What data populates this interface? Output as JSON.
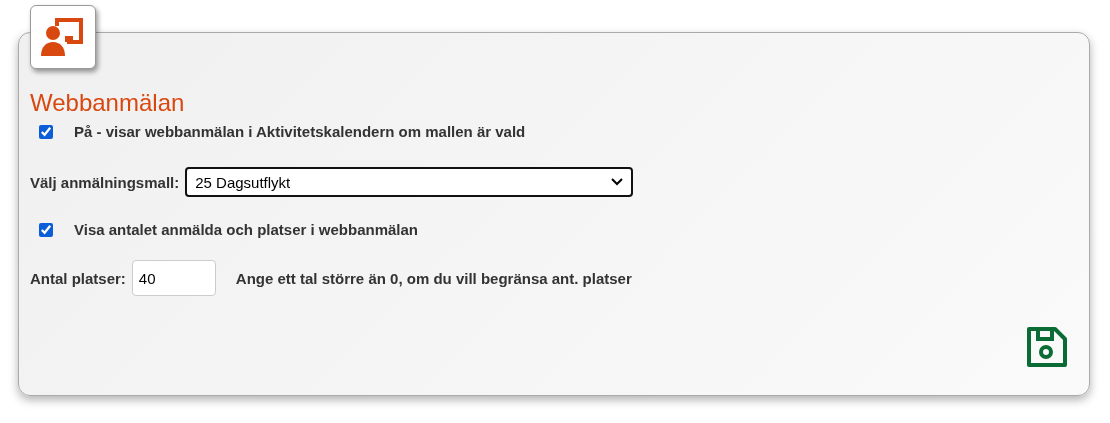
{
  "title": "Webbanmälan",
  "enabled": {
    "checked": true,
    "label": "På - visar webbanmälan i Aktivitetskalendern om mallen är vald"
  },
  "template": {
    "label": "Välj anmälningsmall:",
    "value": "25 Dagsutflykt"
  },
  "show_count": {
    "checked": true,
    "label": "Visa antalet anmälda och platser i webbanmälan"
  },
  "seats": {
    "label": "Antal platser:",
    "value": "40",
    "hint": "Ange ett tal större än 0, om du vill begränsa ant. platser"
  }
}
